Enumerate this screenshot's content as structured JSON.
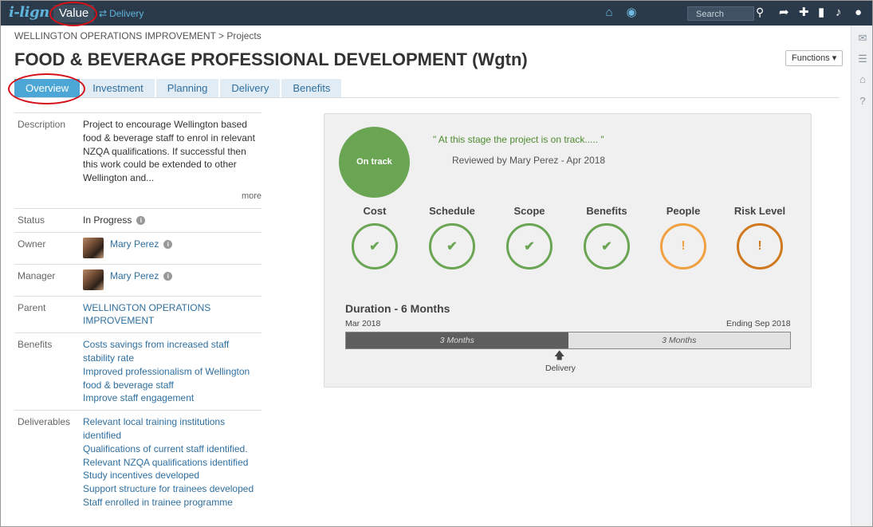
{
  "topbar": {
    "logo": "i-lign",
    "value_label": "Value",
    "delivery_label": "Delivery",
    "search_placeholder": "Search"
  },
  "header": {
    "breadcrumb": "WELLINGTON OPERATIONS IMPROVEMENT > Projects",
    "title": "FOOD & BEVERAGE PROFESSIONAL DEVELOPMENT (Wgtn)",
    "functions_label": "Functions ▾"
  },
  "tabs": [
    {
      "label": "Overview"
    },
    {
      "label": "Investment"
    },
    {
      "label": "Planning"
    },
    {
      "label": "Delivery"
    },
    {
      "label": "Benefits"
    }
  ],
  "details": {
    "description_label": "Description",
    "description": "Project to encourage Wellington based food & beverage staff to enrol in relevant NZQA qualifications. If successful then this work could be extended to other Wellington and...",
    "more": "more",
    "status_label": "Status",
    "status": "In Progress",
    "owner_label": "Owner",
    "owner": "Mary Perez",
    "manager_label": "Manager",
    "manager": "Mary Perez",
    "parent_label": "Parent",
    "parent": "WELLINGTON OPERATIONS IMPROVEMENT",
    "benefits_label": "Benefits",
    "benefits": [
      "Costs savings from increased staff stability rate",
      "Improved professionalism of Wellington food & beverage staff",
      "Improve staff engagement"
    ],
    "deliverables_label": "Deliverables",
    "deliverables": [
      "Relevant local training institutions identified",
      "Qualifications of current staff identified.",
      "Relevant NZQA qualifications identified",
      "Study incentives developed",
      "Support structure for trainees developed",
      "Staff enrolled in trainee programme"
    ]
  },
  "status_card": {
    "status": "On track",
    "quote": "\" At this stage the project is on track..... \"",
    "reviewed": "Reviewed by Mary Perez - Apr 2018",
    "metrics": [
      {
        "label": "Cost",
        "state": "ok",
        "symbol": "✔",
        "color": "#6aa553"
      },
      {
        "label": "Schedule",
        "state": "ok",
        "symbol": "✔",
        "color": "#6aa553"
      },
      {
        "label": "Scope",
        "state": "ok",
        "symbol": "✔",
        "color": "#6aa553"
      },
      {
        "label": "Benefits",
        "state": "ok",
        "symbol": "✔",
        "color": "#6aa553"
      },
      {
        "label": "People",
        "state": "warning",
        "symbol": "!",
        "color": "#f0a040"
      },
      {
        "label": "Risk Level",
        "state": "warning",
        "symbol": "!",
        "color": "#d0781e"
      }
    ],
    "duration_title": "Duration - 6 Months",
    "start": "Mar 2018",
    "end": "Ending Sep 2018",
    "elapsed_label": "3 Months",
    "remaining_label": "3 Months",
    "elapsed_fraction": 0.5,
    "marker_label": "Delivery"
  }
}
